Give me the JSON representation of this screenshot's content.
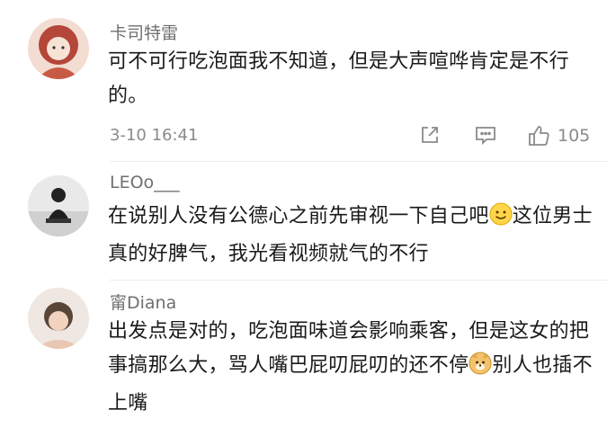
{
  "comments": [
    {
      "username": "卡司特雷",
      "text": "可不可行吃泡面我不知道，但是大声喧哗肯定是不行的。",
      "time": "3-10 16:41",
      "like_count": "105",
      "actions": {
        "share_icon": "share-icon",
        "comment_icon": "comment-icon",
        "like_icon": "thumbs-up-icon"
      }
    },
    {
      "username": "LEOo___",
      "text_part1": "在说别人没有公德心之前先审视一下自己吧",
      "text_part2": "这位男士真的好脾气，我光看视频就气的不行"
    },
    {
      "username": "甯Diana",
      "text_part1": "出发点是对的，吃泡面味道会影响乘客，但是这女的把事搞那么大，骂人嘴巴屁叨屁叨的还不停",
      "text_part2": "别人也插不上嘴"
    }
  ],
  "colors": {
    "text": "#1a1a1a",
    "name": "#6f6f6f",
    "meta": "#8a8a8a",
    "divider": "#ececec"
  }
}
